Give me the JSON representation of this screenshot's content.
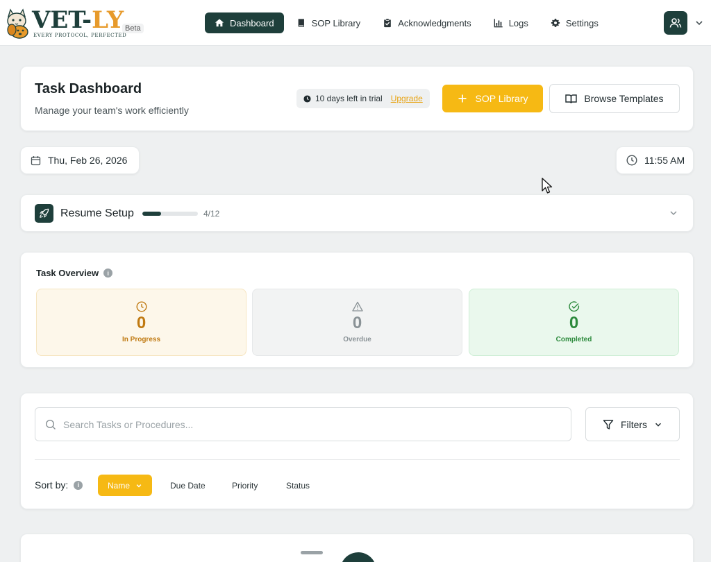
{
  "brand": {
    "name_part1": "VET-",
    "name_part2": "LY",
    "tagline": "EVERY PROTOCOL, PERFECTED",
    "badge": "Beta"
  },
  "nav": {
    "items": [
      {
        "label": "Dashboard",
        "icon": "home-icon",
        "active": true
      },
      {
        "label": "SOP Library",
        "icon": "book-icon",
        "active": false
      },
      {
        "label": "Acknowledgments",
        "icon": "clipboard-check-icon",
        "active": false
      },
      {
        "label": "Logs",
        "icon": "bar-chart-icon",
        "active": false
      },
      {
        "label": "Settings",
        "icon": "gear-icon",
        "active": false
      }
    ]
  },
  "header": {
    "title": "Task Dashboard",
    "subtitle": "Manage your team's work efficiently",
    "trial_text": "10 days left in trial",
    "upgrade_label": "Upgrade",
    "sop_button": "SOP Library",
    "templates_button": "Browse Templates"
  },
  "date": "Thu, Feb 26, 2026",
  "time": "11:55 AM",
  "setup": {
    "label": "Resume Setup",
    "count": "4/12",
    "progress": 0.333
  },
  "overview": {
    "title": "Task Overview",
    "stats": [
      {
        "value": "0",
        "label": "In Progress"
      },
      {
        "value": "0",
        "label": "Overdue"
      },
      {
        "value": "0",
        "label": "Completed"
      }
    ]
  },
  "search": {
    "placeholder": "Search Tasks or Procedures...",
    "filters_label": "Filters"
  },
  "sort": {
    "label": "Sort by:",
    "options": [
      "Name",
      "Due Date",
      "Priority",
      "Status"
    ]
  },
  "colors": {
    "primary": "#1e3f3b",
    "accent": "#f6b914",
    "in_progress": "#c07a12",
    "overdue": "#8a9296",
    "completed": "#2c8a3c"
  }
}
